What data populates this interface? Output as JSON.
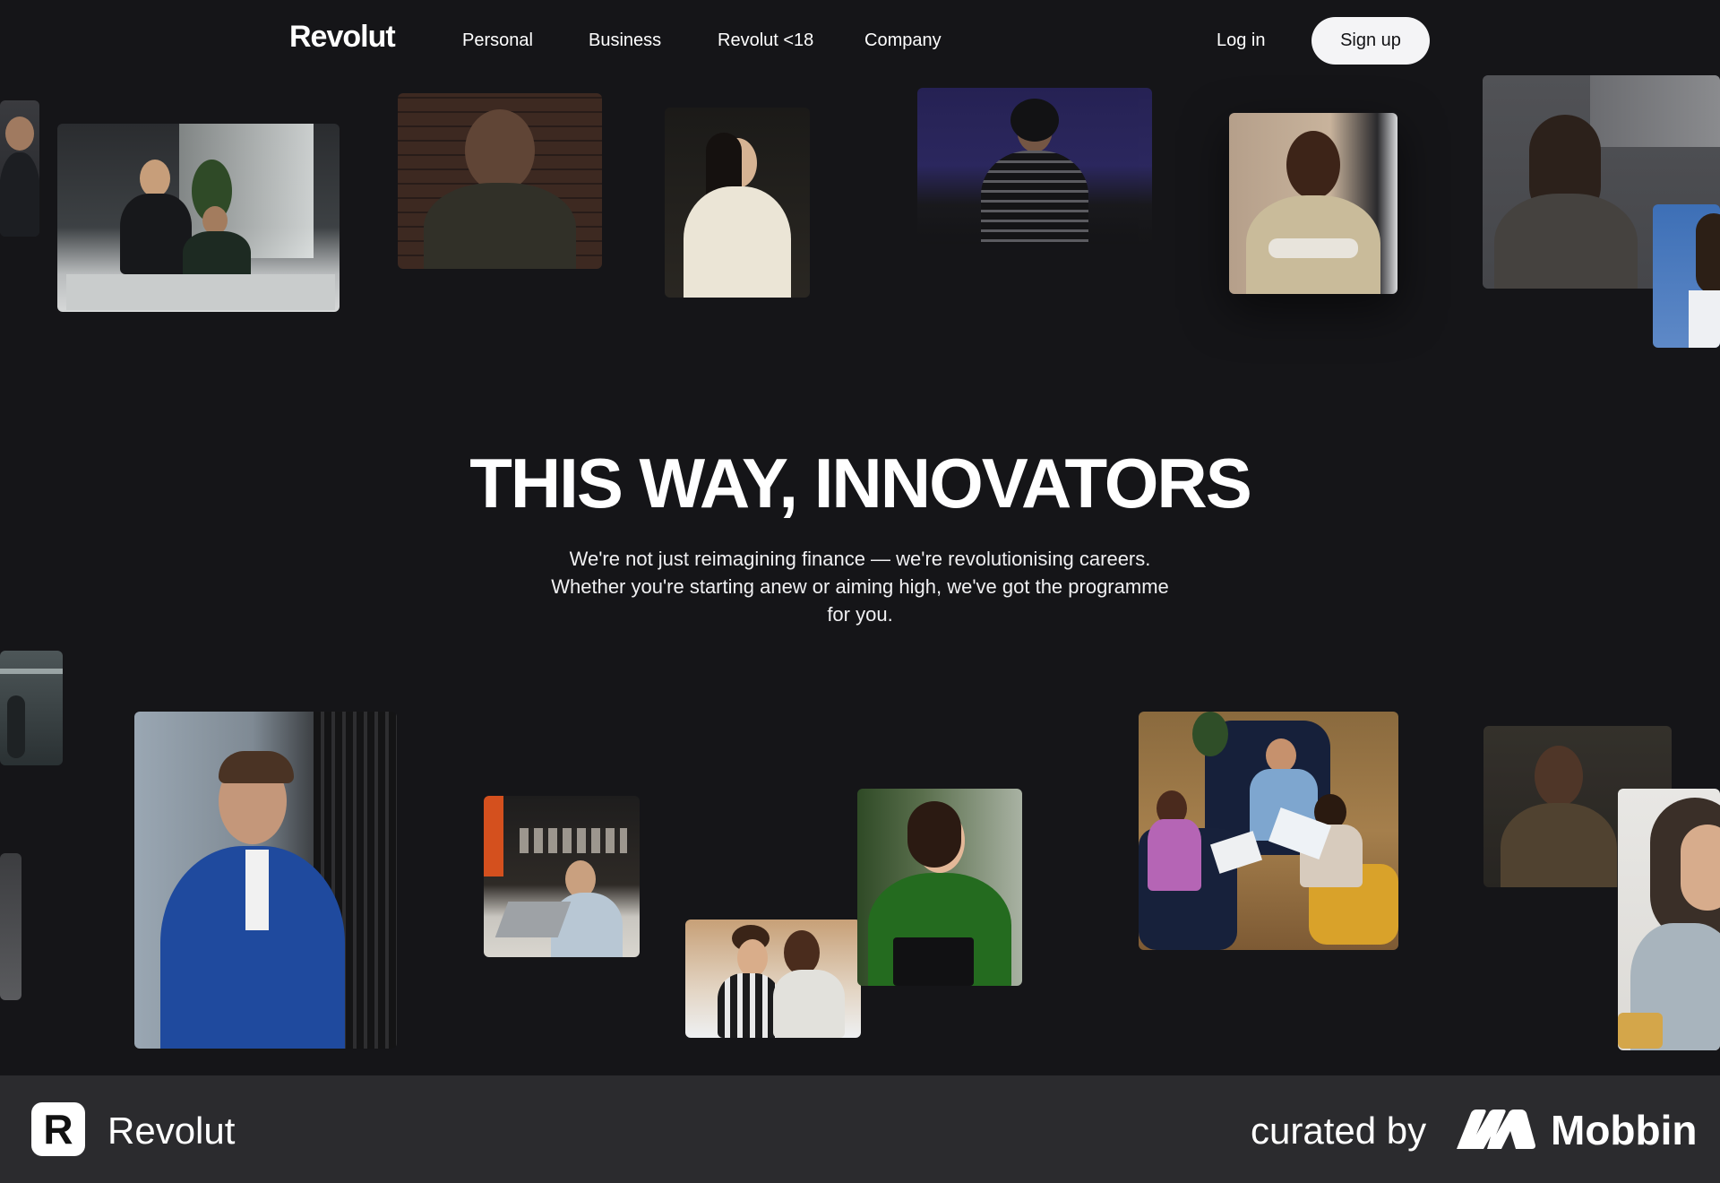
{
  "nav": {
    "logo": "Revolut",
    "links": [
      "Personal",
      "Business",
      "Revolut <18",
      "Company"
    ],
    "login": "Log in",
    "signup": "Sign up"
  },
  "hero": {
    "title": "THIS WAY, INNOVATORS",
    "subtitle_line1": "We're not just reimagining finance — we're revolutionising careers.",
    "subtitle_line2": "Whether you're starting anew or aiming high, we've got the programme",
    "subtitle_line3": "for you."
  },
  "footer": {
    "brand": "Revolut",
    "curated_by": "curated by",
    "partner": "Mobbin"
  },
  "colors": {
    "background": "#151518",
    "footer": "#2b2b2e",
    "signup_bg": "#f4f4f6"
  }
}
